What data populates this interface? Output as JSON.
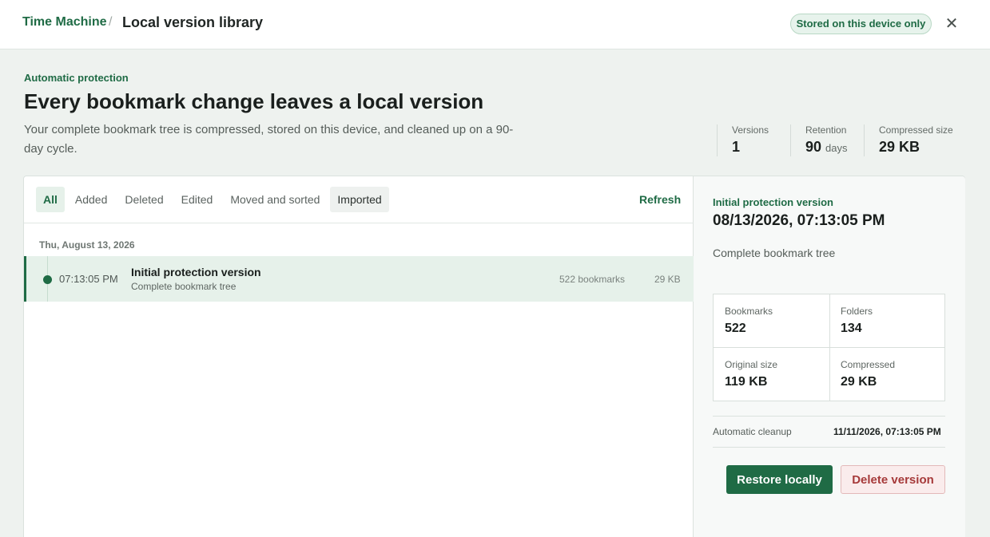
{
  "header": {
    "app_name": "Time Machine",
    "separator": "/",
    "current_page": "Local version library",
    "storage_badge": "Stored on this device only",
    "close_glyph": "✕"
  },
  "hero": {
    "eyebrow": "Automatic protection",
    "title": "Every bookmark change leaves a local version",
    "description": "Your complete bookmark tree is compressed, stored on this device, and cleaned up on a 90-day cycle."
  },
  "stats": {
    "versions": {
      "label": "Versions",
      "value": "1"
    },
    "retention": {
      "label": "Retention",
      "value": "90",
      "unit": "days"
    },
    "compressed": {
      "label": "Compressed size",
      "value": "29 KB"
    }
  },
  "filters": {
    "items": [
      "All",
      "Added",
      "Deleted",
      "Edited",
      "Moved and sorted",
      "Imported"
    ],
    "active": "All",
    "refresh_label": "Refresh"
  },
  "versions_list": {
    "groups": [
      {
        "date": "Thu, August 13, 2026",
        "entries": [
          {
            "time": "07:13:05 PM",
            "title": "Initial protection version",
            "subtitle": "Complete bookmark tree",
            "bookmarks": "522 bookmarks",
            "size": "29 KB"
          }
        ]
      }
    ]
  },
  "detail": {
    "eyebrow": "Initial protection version",
    "timestamp": "08/13/2026, 07:13:05 PM",
    "description": "Complete bookmark tree",
    "metrics": {
      "bookmarks": {
        "label": "Bookmarks",
        "value": "522"
      },
      "folders": {
        "label": "Folders",
        "value": "134"
      },
      "original_size": {
        "label": "Original size",
        "value": "119 KB"
      },
      "compressed": {
        "label": "Compressed",
        "value": "29 KB"
      }
    },
    "cleanup_label": "Automatic cleanup",
    "cleanup_value": "11/11/2026, 07:13:05 PM",
    "restore_label": "Restore locally",
    "delete_label": "Delete version"
  },
  "colors": {
    "accent": "#1f6b45",
    "danger": "#a63a3a",
    "background": "#eef2ef"
  },
  "icons": {
    "close": "close-icon",
    "timeline_dot": "timeline-dot-icon"
  }
}
